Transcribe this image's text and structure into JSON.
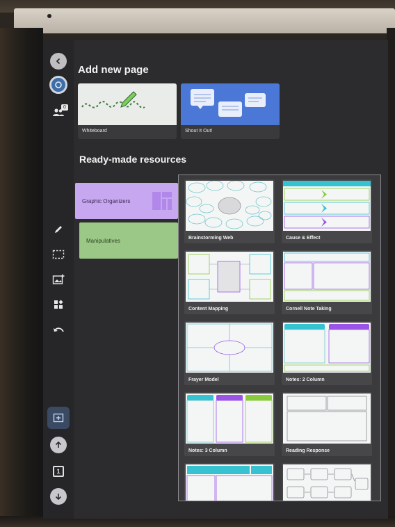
{
  "sections": {
    "add_new_page": "Add new page",
    "ready_made": "Ready-made resources"
  },
  "new_page_templates": [
    {
      "label": "Whiteboard"
    },
    {
      "label": "Shout It Out!"
    }
  ],
  "sidebar": {
    "users_badge": "0",
    "page_number": "1"
  },
  "categories": [
    {
      "label": "Graphic Organizers",
      "color": "#c7a7ef"
    },
    {
      "label": "Manipulatives",
      "color": "#9bc887"
    }
  ],
  "resources": [
    {
      "label": "Brainstorming Web"
    },
    {
      "label": "Cause & Effect"
    },
    {
      "label": "Content Mapping"
    },
    {
      "label": "Cornell Note Taking"
    },
    {
      "label": "Frayer Model"
    },
    {
      "label": "Notes: 2 Column"
    },
    {
      "label": "Notes: 3 Column"
    },
    {
      "label": "Reading Response"
    }
  ],
  "colors": {
    "accent_teal": "#36c2d0",
    "accent_purple": "#9a55e6",
    "accent_green": "#8acb3d"
  }
}
